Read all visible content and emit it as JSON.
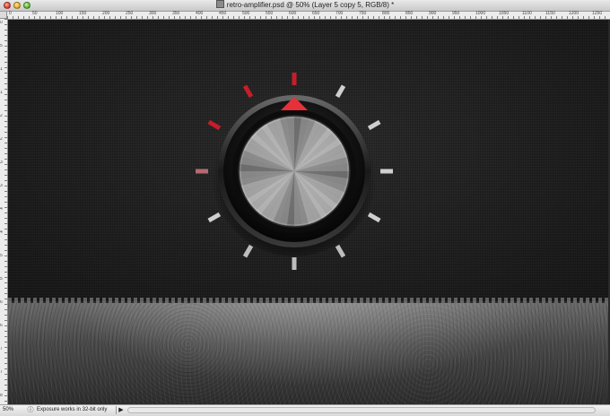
{
  "window": {
    "title": "retro-amplifier.psd @ 50% (Layer 5 copy 5, RGB/8) *"
  },
  "ruler": {
    "horizontal_labels": [
      "0",
      "50",
      "100",
      "150",
      "200",
      "250",
      "300",
      "350",
      "400",
      "450",
      "500",
      "550",
      "600",
      "650",
      "700",
      "750",
      "800",
      "850",
      "900",
      "950",
      "1000",
      "1050",
      "1100",
      "1150",
      "1200",
      "1250"
    ],
    "vertical_labels": [
      "0",
      "50",
      "100",
      "150",
      "200",
      "250",
      "300",
      "350",
      "400",
      "450",
      "500",
      "550",
      "600",
      "650",
      "700",
      "750",
      "800"
    ]
  },
  "knob": {
    "indicator_color": "#e8303a",
    "active_tick_color": "#c41e2a",
    "inactive_tick_color": "#cfcfcf",
    "active_ticks": 4,
    "total_ticks": 12
  },
  "statusbar": {
    "zoom": "50%",
    "message": "Exposure works in 32-bit only",
    "arrow": "▶"
  },
  "icons": {
    "status_icon": "info-icon",
    "doc_icon": "document-icon"
  }
}
